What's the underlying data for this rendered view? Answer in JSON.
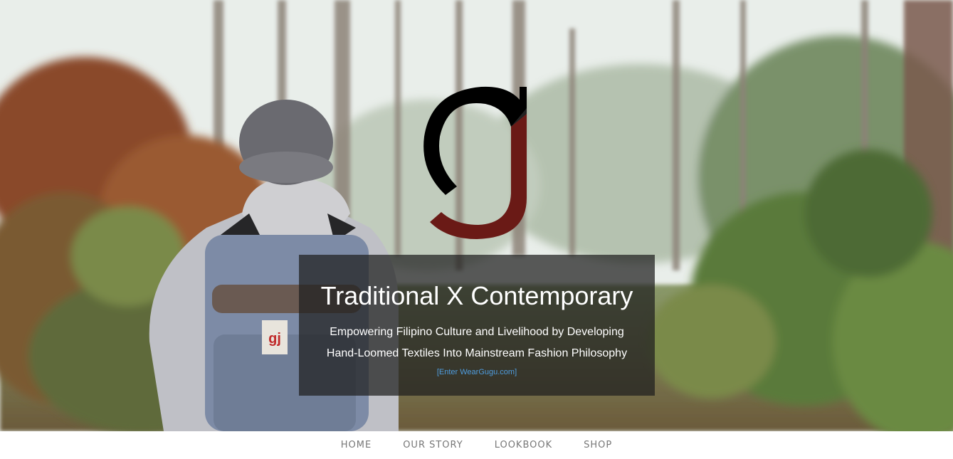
{
  "hero": {
    "title": "Traditional X Contemporary",
    "subtitle_line1": "Empowering Filipino Culture and Livelihood by Developing",
    "subtitle_line2": "Hand-Loomed Textiles Into Mainstream Fashion Philosophy",
    "enter_link": "[Enter WearGugu.com]"
  },
  "nav": {
    "items": [
      {
        "label": "HOME"
      },
      {
        "label": "OUR STORY"
      },
      {
        "label": "LOOKBOOK"
      },
      {
        "label": "SHOP"
      }
    ]
  },
  "colors": {
    "logo_black": "#000000",
    "logo_red": "#6a1a16",
    "caption_bg": "#1e1e1e",
    "link_blue": "#4f9de0",
    "nav_text": "#777777"
  },
  "icons": {
    "logo": "gj-monogram-logo",
    "backpack_badge": "gj-badge-icon"
  }
}
